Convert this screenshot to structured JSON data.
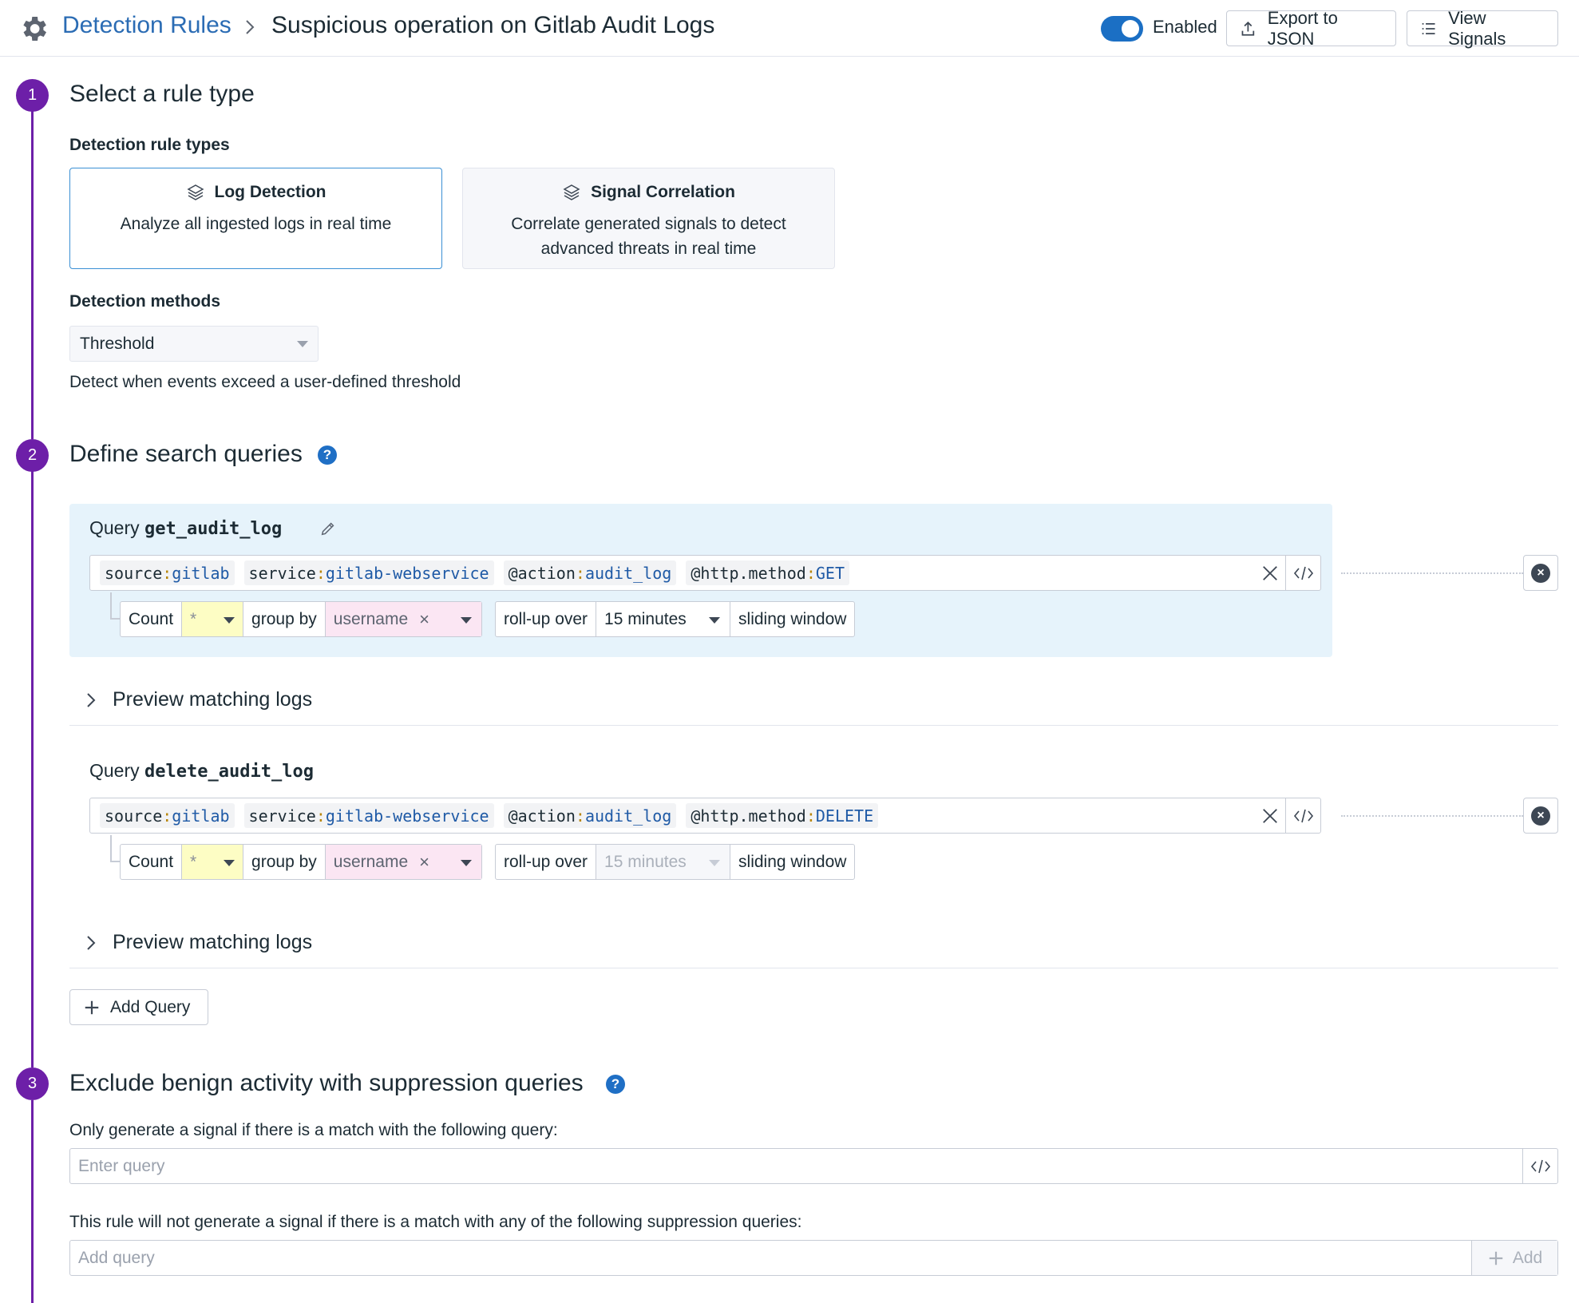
{
  "header": {
    "breadcrumb_link": "Detection Rules",
    "title": "Suspicious operation on Gitlab Audit Logs",
    "toggle_label": "Enabled",
    "export_label": "Export to JSON",
    "view_signals_label": "View Signals"
  },
  "step1": {
    "number": "1",
    "title": "Select a rule type",
    "types_label": "Detection rule types",
    "cards": [
      {
        "title": "Log Detection",
        "desc": "Analyze all ingested logs in real time",
        "selected": true
      },
      {
        "title": "Signal Correlation",
        "desc": "Correlate generated signals to detect advanced threats in real time",
        "selected": false
      }
    ],
    "methods_label": "Detection methods",
    "method_value": "Threshold",
    "method_desc": "Detect when events exceed a user-defined threshold"
  },
  "step2": {
    "number": "2",
    "title": "Define search queries",
    "help_icon": "?",
    "query_prefix": "Query",
    "queries": [
      {
        "name": "get_audit_log",
        "tokens": [
          {
            "k": "source",
            "v": "gitlab"
          },
          {
            "k": "service",
            "v": "gitlab-webservice"
          },
          {
            "k": "@action",
            "v": "audit_log"
          },
          {
            "k": "@http.method",
            "v": "GET"
          }
        ],
        "count": "Count",
        "measure": "*",
        "group_by": "group by",
        "group_value": "username",
        "rollup": "roll-up over",
        "window": "15 minutes",
        "sliding": "sliding window"
      },
      {
        "name": "delete_audit_log",
        "tokens": [
          {
            "k": "source",
            "v": "gitlab"
          },
          {
            "k": "service",
            "v": "gitlab-webservice"
          },
          {
            "k": "@action",
            "v": "audit_log"
          },
          {
            "k": "@http.method",
            "v": "DELETE"
          }
        ],
        "count": "Count",
        "measure": "*",
        "group_by": "group by",
        "group_value": "username",
        "rollup": "roll-up over",
        "window": "15 minutes",
        "sliding": "sliding window"
      }
    ],
    "preview_label": "Preview matching logs",
    "add_query_label": "Add Query"
  },
  "step3": {
    "number": "3",
    "title": "Exclude benign activity with suppression queries",
    "help_icon": "?",
    "only_label": "Only generate a signal if there is a match with the following query:",
    "only_placeholder": "Enter query",
    "suppress_label": "This rule will not generate a signal if there is a match with any of the following suppression queries:",
    "suppress_placeholder": "Add query",
    "add_label": "Add"
  },
  "colors": {
    "accent": "#6d1fa8",
    "link": "#2b6cb4",
    "toggle": "#1b6fc4"
  }
}
